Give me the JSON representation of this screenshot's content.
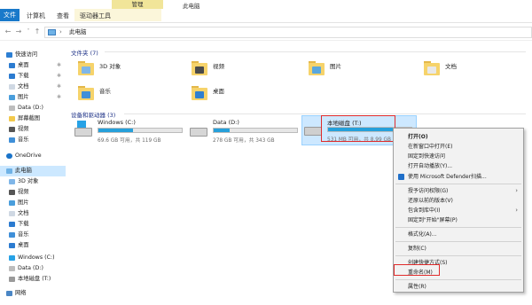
{
  "ribbon": {
    "tab_file": "文件",
    "tab_computer": "计算机",
    "tab_view": "查看",
    "tab_drive_tools": "驱动器工具",
    "context_manage": "管理",
    "window_title": "此电脑"
  },
  "address": {
    "path": "此电脑"
  },
  "sidebar": {
    "items": [
      {
        "label": "快速访问",
        "pin": false
      },
      {
        "label": "桌面",
        "pin": true
      },
      {
        "label": "下载",
        "pin": true
      },
      {
        "label": "文档",
        "pin": true
      },
      {
        "label": "图片",
        "pin": true
      },
      {
        "label": "Data (D:)",
        "pin": false
      },
      {
        "label": "屏幕截图",
        "pin": false
      },
      {
        "label": "视频",
        "pin": false
      },
      {
        "label": "音乐",
        "pin": false
      },
      {
        "label": "OneDrive",
        "pin": false
      },
      {
        "label": "此电脑",
        "pin": false
      },
      {
        "label": "3D 对象",
        "pin": false
      },
      {
        "label": "视频",
        "pin": false
      },
      {
        "label": "图片",
        "pin": false
      },
      {
        "label": "文档",
        "pin": false
      },
      {
        "label": "下载",
        "pin": false
      },
      {
        "label": "音乐",
        "pin": false
      },
      {
        "label": "桌面",
        "pin": false
      },
      {
        "label": "Windows (C:)",
        "pin": false
      },
      {
        "label": "Data (D:)",
        "pin": false
      },
      {
        "label": "本地磁盘 (T:)",
        "pin": false
      },
      {
        "label": "网络",
        "pin": false
      }
    ]
  },
  "folders": {
    "header": "文件夹 (7)",
    "items": [
      {
        "label": "3D 对象",
        "badge_color": "#7fb6e8"
      },
      {
        "label": "视频",
        "badge_color": "#4a4a4a"
      },
      {
        "label": "图片",
        "badge_color": "#5aa7de"
      },
      {
        "label": "文档",
        "badge_color": "#e8e8e8"
      },
      {
        "label": "音乐",
        "badge_color": "#3f8fd8"
      },
      {
        "label": "桌面",
        "badge_color": "#2f7fd0"
      }
    ]
  },
  "drives": {
    "header": "设备和驱动器 (3)",
    "items": [
      {
        "name": "Windows (C:)",
        "free": "69.6 GB 可用，共 119 GB",
        "used_fraction": 0.42
      },
      {
        "name": "Data (D:)",
        "free": "278 GB 可用，共 343 GB",
        "used_fraction": 0.19
      },
      {
        "name": "本地磁盘 (T:)",
        "free": "531 MB 可用，共 8.99 GB",
        "used_fraction": 0.94
      }
    ]
  },
  "context_menu": {
    "items": [
      "打开(O)",
      "在新窗口中打开(E)",
      "固定到快速访问",
      "打开自动播放(Y)...",
      "使用 Microsoft Defender扫描...",
      "授予访问权限(G)",
      "还原以前的版本(V)",
      "包含到库中(I)",
      "固定到\"开始\"屏幕(P)",
      "格式化(A)...",
      "复制(C)",
      "创建快捷方式(S)",
      "重命名(M)",
      "属性(R)"
    ]
  },
  "colors": {
    "accent": "#1979ca",
    "selection": "#cce8ff",
    "highlight_box": "#e02b2b",
    "drive_bar": "#26a0da"
  }
}
